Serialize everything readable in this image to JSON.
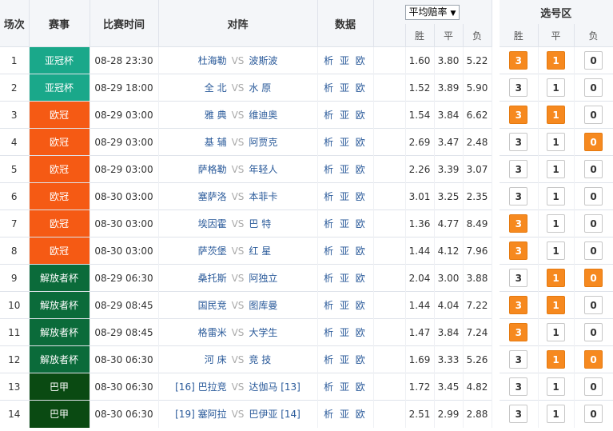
{
  "headers": {
    "idx": "场次",
    "league": "赛事",
    "time": "比赛时间",
    "match": "对阵",
    "data": "数据",
    "odds_select": "平均赔率",
    "odds_win": "胜",
    "odds_draw": "平",
    "odds_lose": "负",
    "pick_title": "选号区",
    "pick_win": "胜",
    "pick_draw": "平",
    "pick_lose": "负"
  },
  "vs_label": "VS",
  "data_links": "析 亚 欧",
  "option_labels": [
    "3",
    "1",
    "0"
  ],
  "colors": {
    "afc": "#1aa88a",
    "ucl": "#f55a14",
    "liberation": "#0b6b3a",
    "brazil": "#0a4a12",
    "selected": "#f6891f"
  },
  "rows": [
    {
      "idx": "1",
      "league": "亚冠杯",
      "league_color": "#1aa88a",
      "time": "08-28 23:30",
      "home": "杜海勒",
      "away": "波斯波",
      "w": "1.60",
      "d": "3.80",
      "l": "5.22",
      "sel": [
        true,
        true,
        false
      ]
    },
    {
      "idx": "2",
      "league": "亚冠杯",
      "league_color": "#1aa88a",
      "time": "08-29 18:00",
      "home": "全 北",
      "away": "水 原",
      "w": "1.52",
      "d": "3.89",
      "l": "5.90",
      "sel": [
        false,
        false,
        false
      ]
    },
    {
      "idx": "3",
      "league": "欧冠",
      "league_color": "#f55a14",
      "time": "08-29 03:00",
      "home": "雅 典",
      "away": "维迪奥",
      "w": "1.54",
      "d": "3.84",
      "l": "6.62",
      "sel": [
        true,
        true,
        false
      ]
    },
    {
      "idx": "4",
      "league": "欧冠",
      "league_color": "#f55a14",
      "time": "08-29 03:00",
      "home": "基 辅",
      "away": "阿贾克",
      "w": "2.69",
      "d": "3.47",
      "l": "2.48",
      "sel": [
        false,
        false,
        true
      ]
    },
    {
      "idx": "5",
      "league": "欧冠",
      "league_color": "#f55a14",
      "time": "08-29 03:00",
      "home": "萨格勒",
      "away": "年轻人",
      "w": "2.26",
      "d": "3.39",
      "l": "3.07",
      "sel": [
        false,
        false,
        false
      ]
    },
    {
      "idx": "6",
      "league": "欧冠",
      "league_color": "#f55a14",
      "time": "08-30 03:00",
      "home": "塞萨洛",
      "away": "本菲卡",
      "w": "3.01",
      "d": "3.25",
      "l": "2.35",
      "sel": [
        false,
        false,
        false
      ]
    },
    {
      "idx": "7",
      "league": "欧冠",
      "league_color": "#f55a14",
      "time": "08-30 03:00",
      "home": "埃因霍",
      "away": "巴 特",
      "w": "1.36",
      "d": "4.77",
      "l": "8.49",
      "sel": [
        true,
        false,
        false
      ]
    },
    {
      "idx": "8",
      "league": "欧冠",
      "league_color": "#f55a14",
      "time": "08-30 03:00",
      "home": "萨茨堡",
      "away": "红 星",
      "w": "1.44",
      "d": "4.12",
      "l": "7.96",
      "sel": [
        true,
        false,
        false
      ]
    },
    {
      "idx": "9",
      "league": "解放者杯",
      "league_color": "#0b6b3a",
      "time": "08-29 06:30",
      "home": "桑托斯",
      "away": "阿独立",
      "w": "2.04",
      "d": "3.00",
      "l": "3.88",
      "sel": [
        false,
        true,
        true
      ]
    },
    {
      "idx": "10",
      "league": "解放者杯",
      "league_color": "#0b6b3a",
      "time": "08-29 08:45",
      "home": "国民竞",
      "away": "图库曼",
      "w": "1.44",
      "d": "4.04",
      "l": "7.22",
      "sel": [
        true,
        true,
        false
      ]
    },
    {
      "idx": "11",
      "league": "解放者杯",
      "league_color": "#0b6b3a",
      "time": "08-29 08:45",
      "home": "格雷米",
      "away": "大学生",
      "w": "1.47",
      "d": "3.84",
      "l": "7.24",
      "sel": [
        true,
        false,
        false
      ]
    },
    {
      "idx": "12",
      "league": "解放者杯",
      "league_color": "#0b6b3a",
      "time": "08-30 06:30",
      "home": "河 床",
      "away": "竞 技",
      "w": "1.69",
      "d": "3.33",
      "l": "5.26",
      "sel": [
        false,
        true,
        true
      ]
    },
    {
      "idx": "13",
      "league": "巴甲",
      "league_color": "#0a4a12",
      "time": "08-30 06:30",
      "home": "[16] 巴拉竞",
      "away": "达伽马 [13]",
      "w": "1.72",
      "d": "3.45",
      "l": "4.82",
      "sel": [
        false,
        false,
        false
      ]
    },
    {
      "idx": "14",
      "league": "巴甲",
      "league_color": "#0a4a12",
      "time": "08-30 06:30",
      "home": "[19] 塞阿拉",
      "away": "巴伊亚 [14]",
      "w": "2.51",
      "d": "2.99",
      "l": "2.88",
      "sel": [
        false,
        false,
        false
      ]
    }
  ]
}
